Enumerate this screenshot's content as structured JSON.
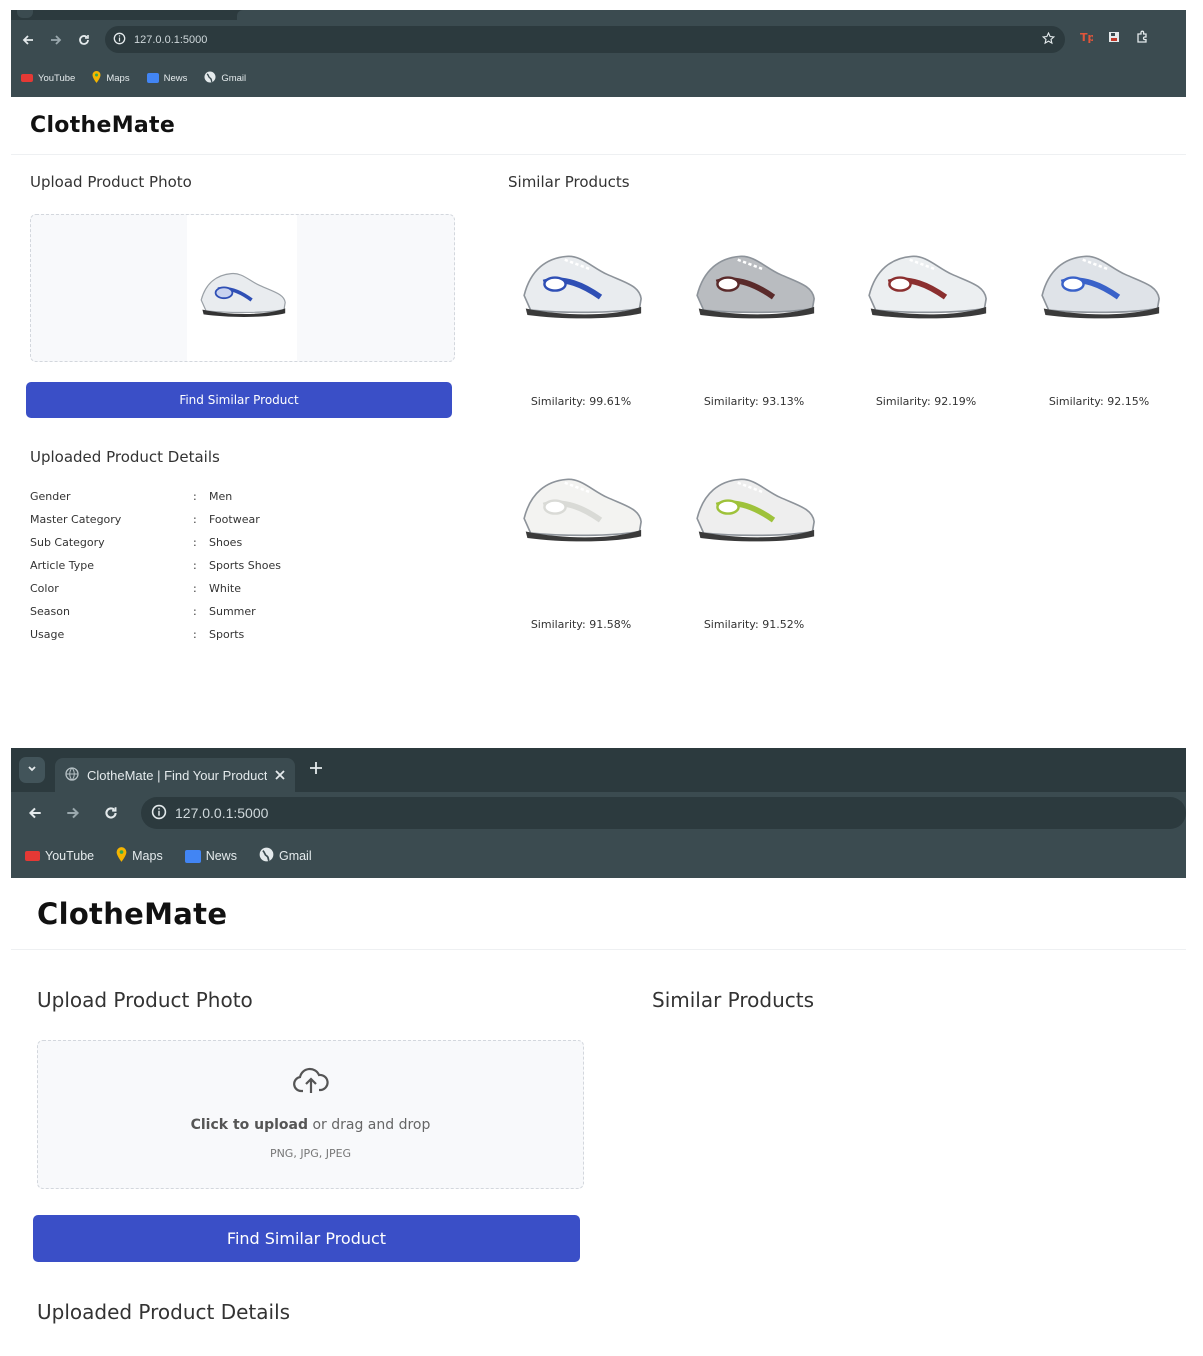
{
  "browser": {
    "url": "127.0.0.1:5000",
    "tab_title": "ClotheMate | Find Your Product",
    "bookmarks": [
      {
        "label": "YouTube",
        "icon": "youtube-icon",
        "color": "#e53935"
      },
      {
        "label": "Maps",
        "icon": "maps-icon",
        "color": "#f4b400"
      },
      {
        "label": "News",
        "icon": "news-icon",
        "color": "#4285f4"
      },
      {
        "label": "Gmail",
        "icon": "globe-icon",
        "color": "#e4eaec"
      }
    ]
  },
  "app": {
    "brand": "ClotheMate",
    "upload_title": "Upload Product Photo",
    "similar_title": "Similar Products",
    "find_button": "Find Similar Product",
    "details_title": "Uploaded Product Details",
    "dropzone": {
      "click_text": "Click to upload",
      "drag_text": " or drag and drop",
      "formats": "PNG, JPG, JPEG"
    }
  },
  "details": [
    {
      "key": "Gender",
      "value": "Men"
    },
    {
      "key": "Master Category",
      "value": "Footwear"
    },
    {
      "key": "Sub Category",
      "value": "Shoes"
    },
    {
      "key": "Article Type",
      "value": "Sports Shoes"
    },
    {
      "key": "Color",
      "value": "White"
    },
    {
      "key": "Season",
      "value": "Summer"
    },
    {
      "key": "Usage",
      "value": "Sports"
    }
  ],
  "products": [
    {
      "similarity": "Similarity: 99.61%",
      "accent": "#2f4fb5",
      "body": "#e9ecef"
    },
    {
      "similarity": "Similarity: 93.13%",
      "accent": "#5a2a2a",
      "body": "#b9bcc0"
    },
    {
      "similarity": "Similarity: 92.19%",
      "accent": "#8b2f2f",
      "body": "#eceff1"
    },
    {
      "similarity": "Similarity: 92.15%",
      "accent": "#3a62c9",
      "body": "#dfe3e8"
    },
    {
      "similarity": "Similarity: 91.58%",
      "accent": "#d9dad6",
      "body": "#f3f3f1"
    },
    {
      "similarity": "Similarity: 91.52%",
      "accent": "#9ec23a",
      "body": "#eeeeee"
    }
  ],
  "colors": {
    "chrome": "#3b4b50",
    "button": "#3a4fc7"
  }
}
